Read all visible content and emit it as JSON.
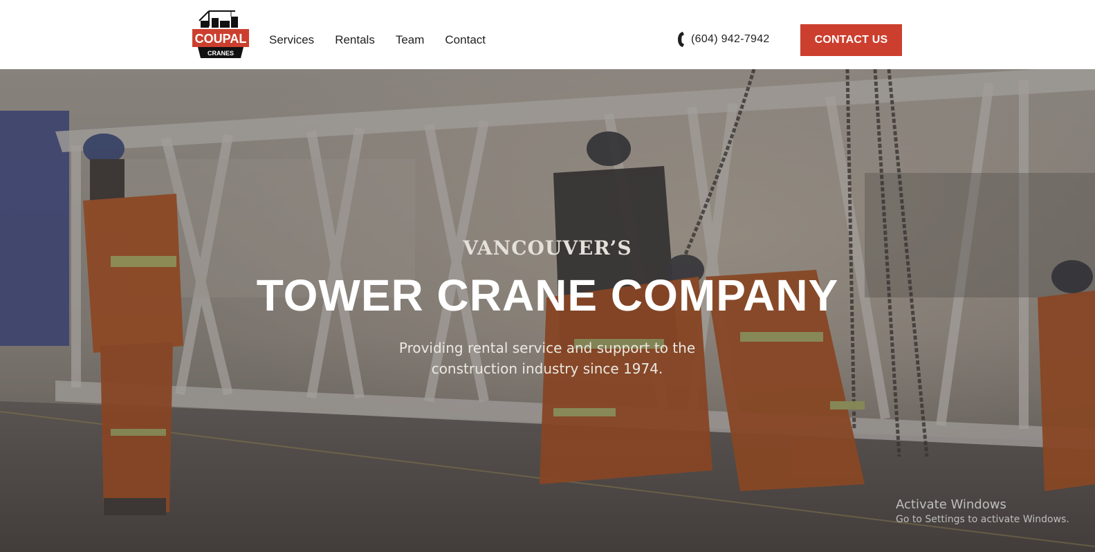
{
  "header": {
    "logo": {
      "text_top": "COUPAL",
      "text_bottom": "CRANES"
    },
    "nav": [
      {
        "label": "Services"
      },
      {
        "label": "Rentals"
      },
      {
        "label": "Team"
      },
      {
        "label": "Contact"
      }
    ],
    "phone": {
      "number": "(604) 942-7942",
      "icon": "phone-icon"
    },
    "cta_label": "CONTACT US"
  },
  "hero": {
    "kicker": "VANCOUVER’S",
    "title": "TOWER CRANE COMPANY",
    "subtitle_line1": "Providing rental service and support to the",
    "subtitle_line2": "construction industry since 1974."
  },
  "watermark": {
    "title": "Activate Windows",
    "subtitle": "Go to Settings to activate Windows."
  },
  "colors": {
    "brand_red": "#cc3f2e",
    "text_dark": "#1f1f1f",
    "hero_text": "#ffffff",
    "hero_overlay": "#373232"
  }
}
